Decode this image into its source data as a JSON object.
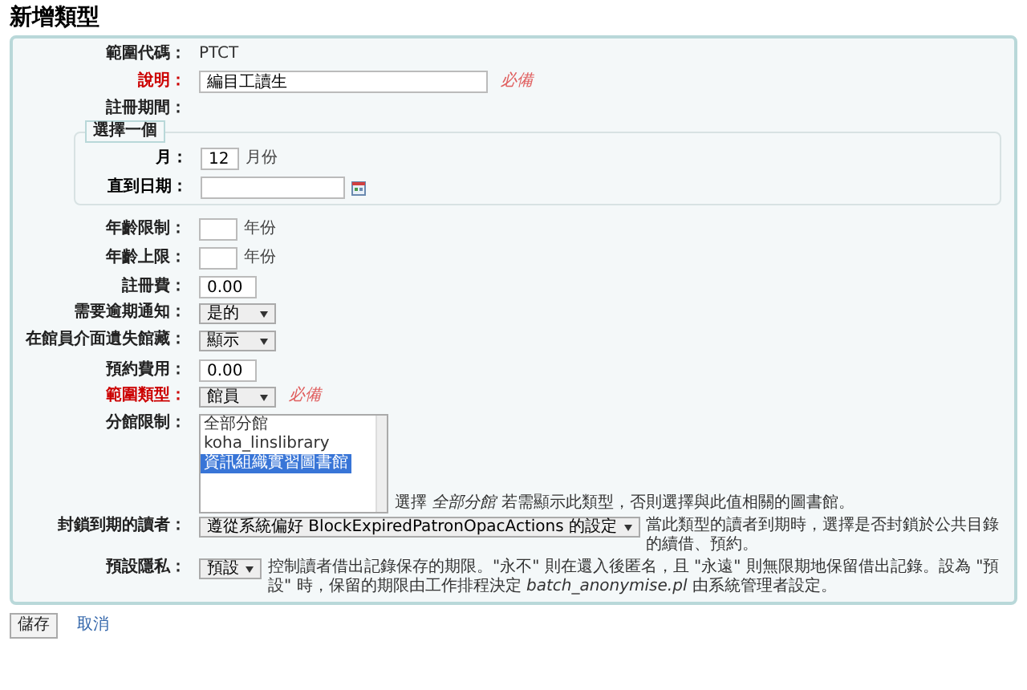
{
  "title": "新增類型",
  "fields_top": [
    {
      "kind": "static",
      "label": "範圍代碼：",
      "required": false,
      "value": "PTCT"
    },
    {
      "kind": "text_input",
      "label": "說明：",
      "required": true,
      "value": "編目工讀生",
      "hint": "必備"
    },
    {
      "kind": "heading",
      "label": "註冊期間：",
      "required": false
    }
  ],
  "period": {
    "legend": "選擇一個",
    "month": {
      "label": "月：",
      "value": "12",
      "unit": "月份"
    },
    "until": {
      "label": "直到日期："
    }
  },
  "fields": [
    {
      "kind": "number_input",
      "label": "年齡限制：",
      "required": false,
      "unit": "年份"
    },
    {
      "kind": "number_input",
      "label": "年齡上限：",
      "required": false,
      "unit": "年份"
    },
    {
      "kind": "number_input",
      "label": "註冊費：",
      "required": false,
      "value": "0.00"
    },
    {
      "kind": "select",
      "label": "需要逾期通知：",
      "required": false,
      "value": "是的"
    },
    {
      "kind": "select",
      "label": "在館員介面遺失館藏：",
      "required": false,
      "value": "顯示"
    },
    {
      "kind": "number_input",
      "label": "預約費用：",
      "required": false,
      "value": "0.00"
    },
    {
      "kind": "select",
      "label": "範圍類型：",
      "required": true,
      "value": "館員",
      "hint": "必備"
    },
    {
      "kind": "listbox",
      "label": "分館限制：",
      "required": false,
      "options": [
        {
          "label": "全部分館",
          "selected": false
        },
        {
          "label": "koha_linslibrary",
          "selected": false
        },
        {
          "label": "資訊組織實習圖書館",
          "selected": true
        }
      ],
      "note": "選擇 *全部分館* 若需顯示此類型，否則選擇與此值相關的圖書館。"
    },
    {
      "kind": "select",
      "label": "封鎖到期的讀者：",
      "required": false,
      "value": "遵從系統偏好 BlockExpiredPatronOpacActions 的設定",
      "note": "當此類型的讀者到期時，選擇是否封鎖於公共目錄的續借、預約。"
    },
    {
      "kind": "select",
      "label": "預設隱私：",
      "required": false,
      "value": "預設",
      "note": "控制讀者借出記錄保存的期限。\"永不\" 則在還入後匿名，且 \"永遠\" 則無限期地保留借出記錄。設為 \"預設\" 時，保留的期限由工作排程決定 *batch_anonymise.pl* 由系統管理者設定。"
    }
  ],
  "actions": {
    "save": "儲存",
    "cancel": "取消"
  }
}
